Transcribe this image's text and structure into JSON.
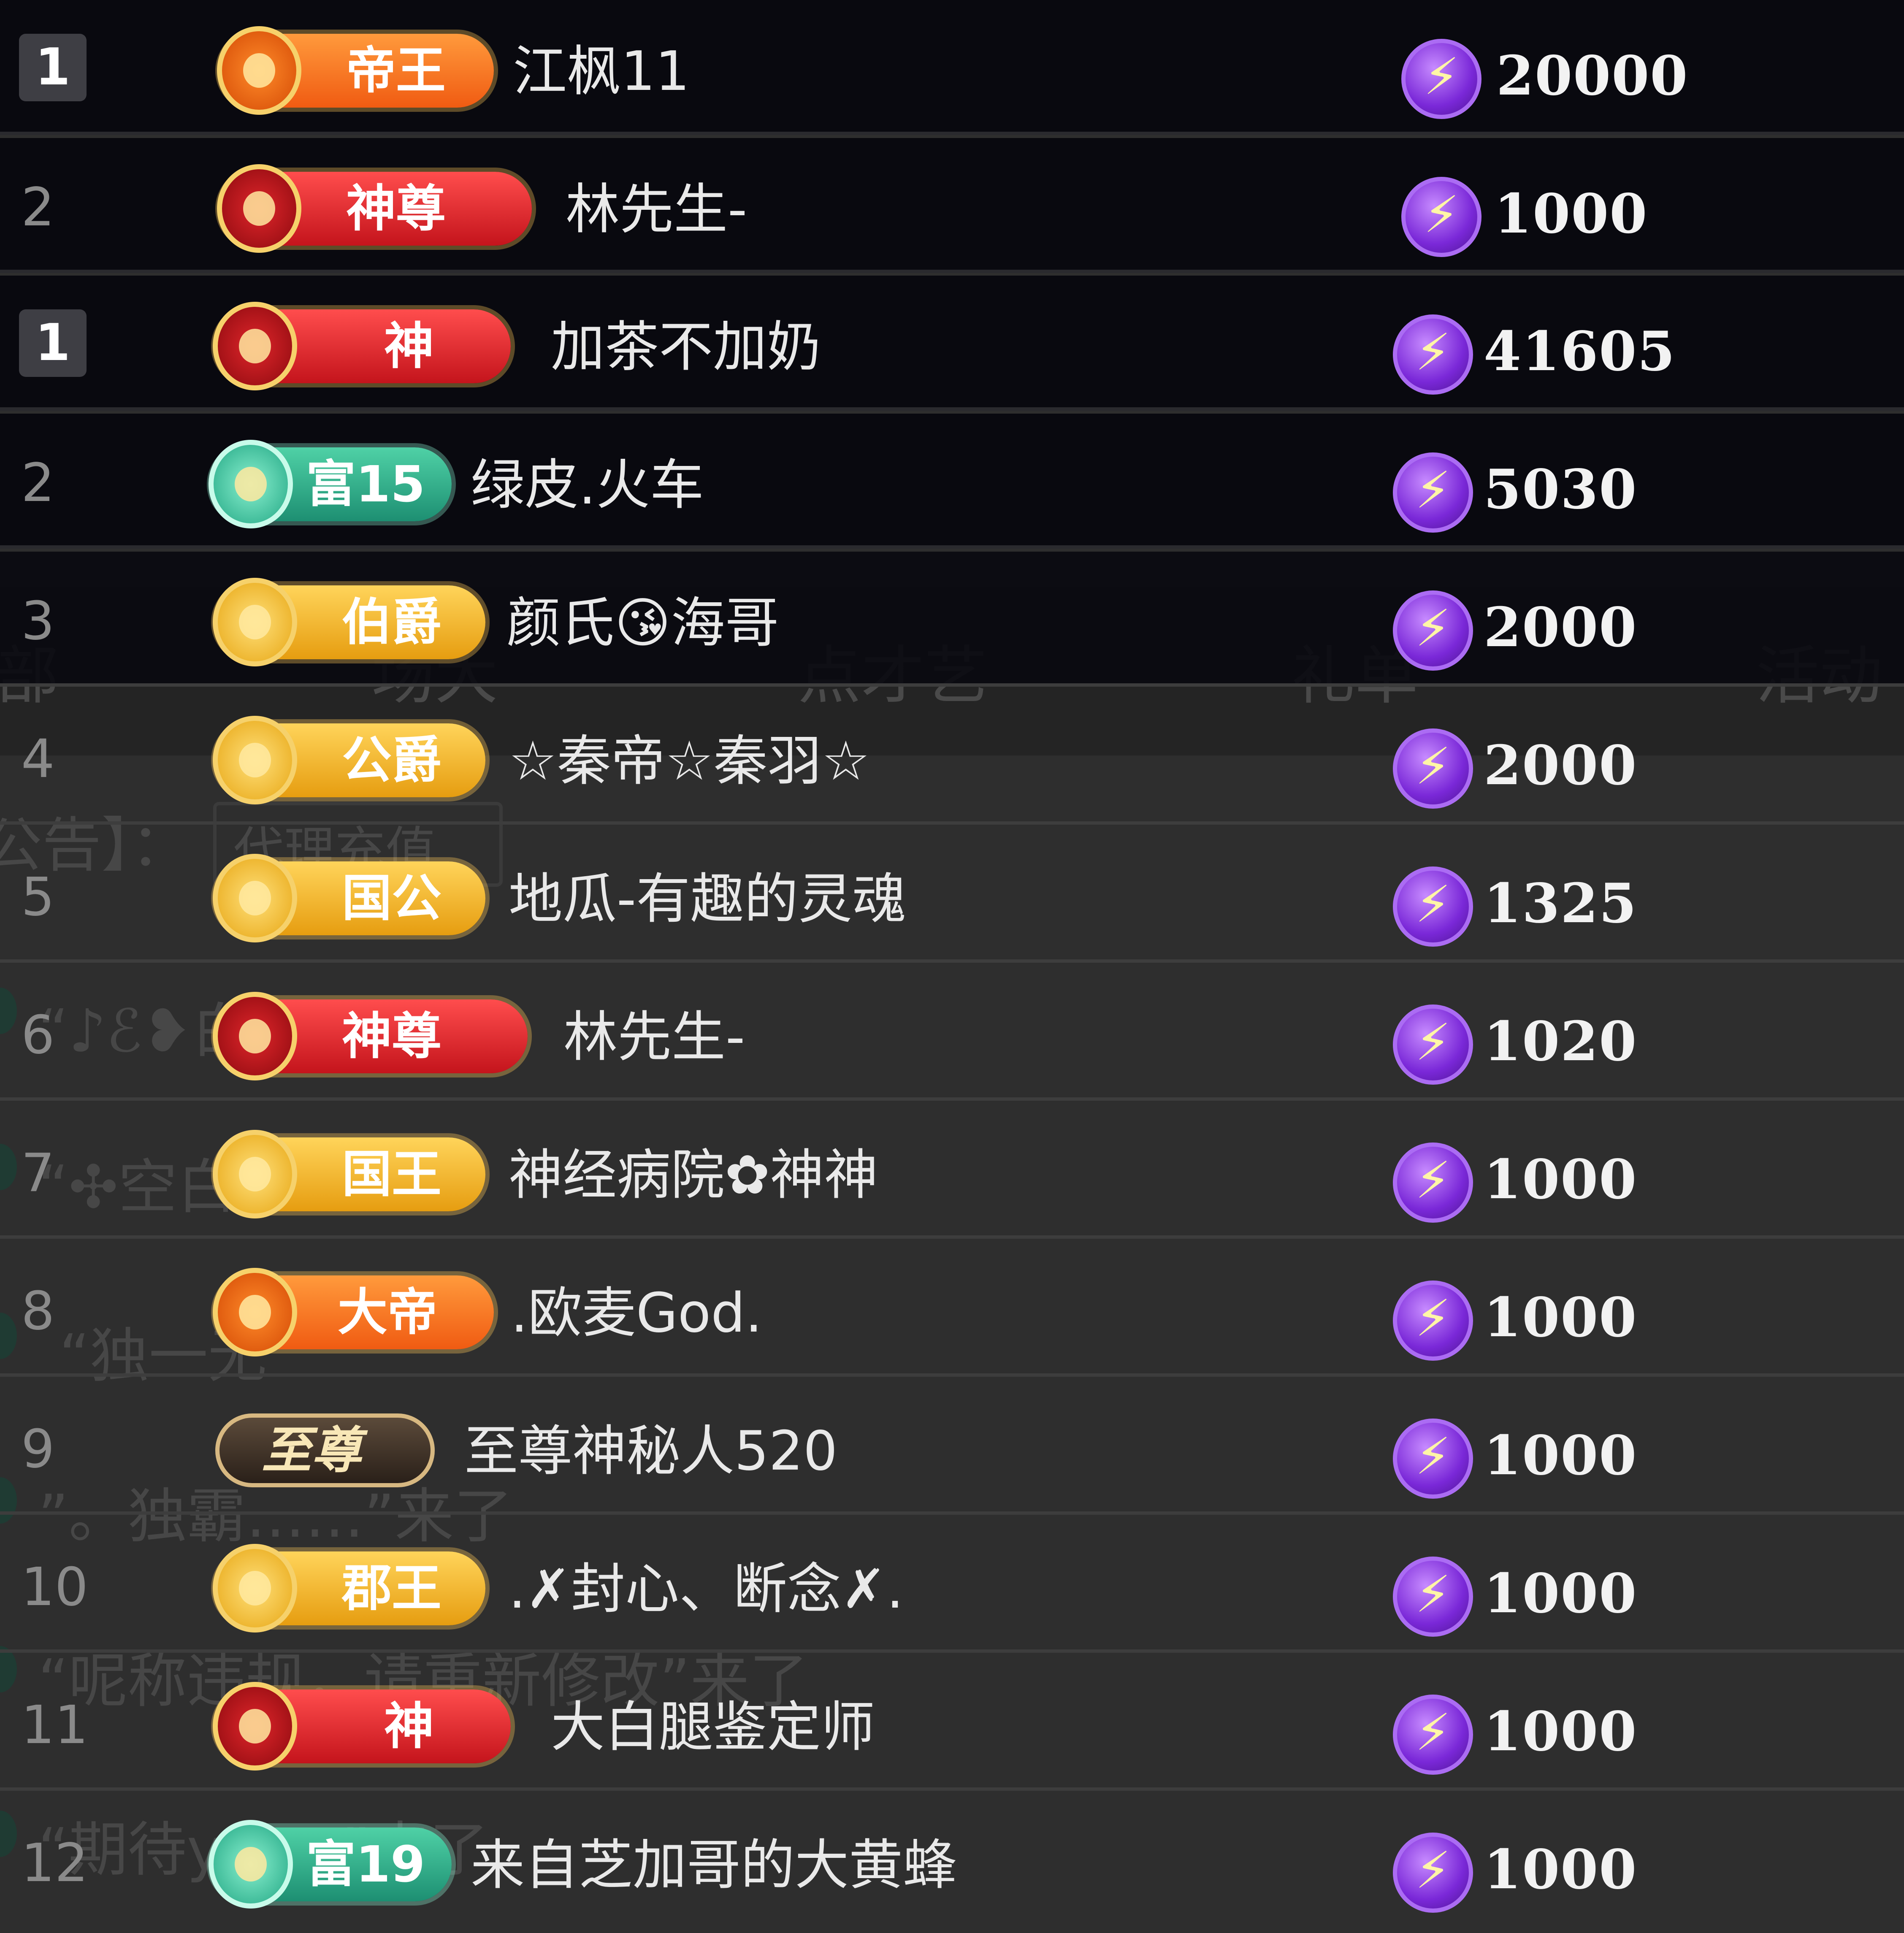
{
  "background": {
    "tabs": [
      "部",
      "场大",
      "点才艺",
      "礼单",
      "活动"
    ],
    "announcement_label": "公告】：",
    "announcement_box": "代理充值",
    "chat_lines": [
      "“♪ℰ❥白先生”来了",
      "“✣空白",
      "“独一无",
      "”。独霸……”来了",
      "“呢称违规，请重新修改”来了",
      "“期待y……”来了"
    ]
  },
  "currency_icon": "lightning-coin-icon",
  "colors": {
    "orange_badge": "#f05b12",
    "red_badge": "#c4141c",
    "gold_badge": "#e69d10",
    "green_badge": "#1d8f72",
    "coin": "#7a28d8"
  },
  "rows": [
    {
      "rank": "1",
      "rank_style": "box",
      "badge": "帝王",
      "badge_color": "orange",
      "name": "江枫11",
      "amount": "20000"
    },
    {
      "rank": "2",
      "rank_style": "plain",
      "badge": "神尊",
      "badge_color": "red",
      "name": "林先生-",
      "amount": "1000"
    },
    {
      "rank": "1",
      "rank_style": "box",
      "badge": "神",
      "badge_color": "red",
      "name": "加茶不加奶",
      "amount": "41605"
    },
    {
      "rank": "2",
      "rank_style": "plain",
      "badge": "富15",
      "badge_color": "green",
      "name": "绿皮.火车",
      "amount": "5030"
    },
    {
      "rank": "3",
      "rank_style": "plain",
      "badge": "伯爵",
      "badge_color": "gold",
      "name": "颜氏😘海哥",
      "amount": "2000"
    },
    {
      "rank": "4",
      "rank_style": "plain",
      "badge": "公爵",
      "badge_color": "gold",
      "name": "☆秦帝☆秦羽☆",
      "amount": "2000"
    },
    {
      "rank": "5",
      "rank_style": "plain",
      "badge": "国公",
      "badge_color": "gold",
      "name": "地瓜-有趣的灵魂",
      "amount": "1325"
    },
    {
      "rank": "6",
      "rank_style": "plain",
      "badge": "神尊",
      "badge_color": "red",
      "name": "林先生-",
      "amount": "1020"
    },
    {
      "rank": "7",
      "rank_style": "plain",
      "badge": "国王",
      "badge_color": "gold",
      "name": "神经病院✿神神",
      "amount": "1000"
    },
    {
      "rank": "8",
      "rank_style": "plain",
      "badge": "大帝",
      "badge_color": "orange",
      "name": ".欧麦God.",
      "amount": "1000"
    },
    {
      "rank": "9",
      "rank_style": "plain",
      "badge": "至尊",
      "badge_color": "supreme",
      "name": "至尊神秘人520",
      "amount": "1000"
    },
    {
      "rank": "10",
      "rank_style": "plain",
      "badge": "郡王",
      "badge_color": "gold",
      "name": ".✗封心、断念✗.",
      "amount": "1000"
    },
    {
      "rank": "11",
      "rank_style": "plain",
      "badge": "神",
      "badge_color": "red",
      "name": "大白腿鉴定师",
      "amount": "1000"
    },
    {
      "rank": "12",
      "rank_style": "plain",
      "badge": "富19",
      "badge_color": "green",
      "name": "来自芝加哥的大黄蜂",
      "amount": "1000"
    }
  ]
}
